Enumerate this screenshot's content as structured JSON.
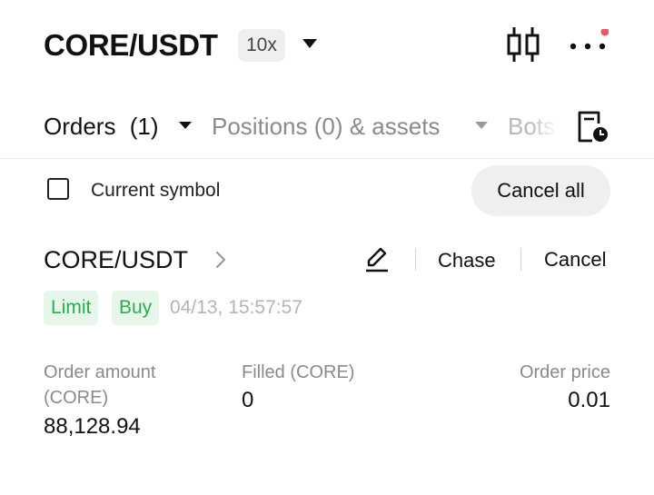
{
  "header": {
    "pair": "CORE/USDT",
    "leverage": "10x",
    "notification_dot_color": "#e8586b"
  },
  "tabs": [
    {
      "label": "Orders",
      "count": "(1)",
      "active": true
    },
    {
      "label": "Positions (0) & assets",
      "active": false
    },
    {
      "label": "Bots",
      "active": false
    }
  ],
  "filter": {
    "checkbox_label": "Current symbol",
    "checked": false,
    "cancel_all_label": "Cancel all"
  },
  "order": {
    "symbol": "CORE/USDT",
    "chase_label": "Chase",
    "cancel_label": "Cancel",
    "order_type": "Limit",
    "side": "Buy",
    "time": "04/13, 15:57:57",
    "amount_label": "Order amount (CORE)",
    "amount_value": "88,128.94",
    "filled_label": "Filled (CORE)",
    "filled_value": "0",
    "price_label": "Order price",
    "price_value": "0.01",
    "accent_color": "#2dab51"
  }
}
